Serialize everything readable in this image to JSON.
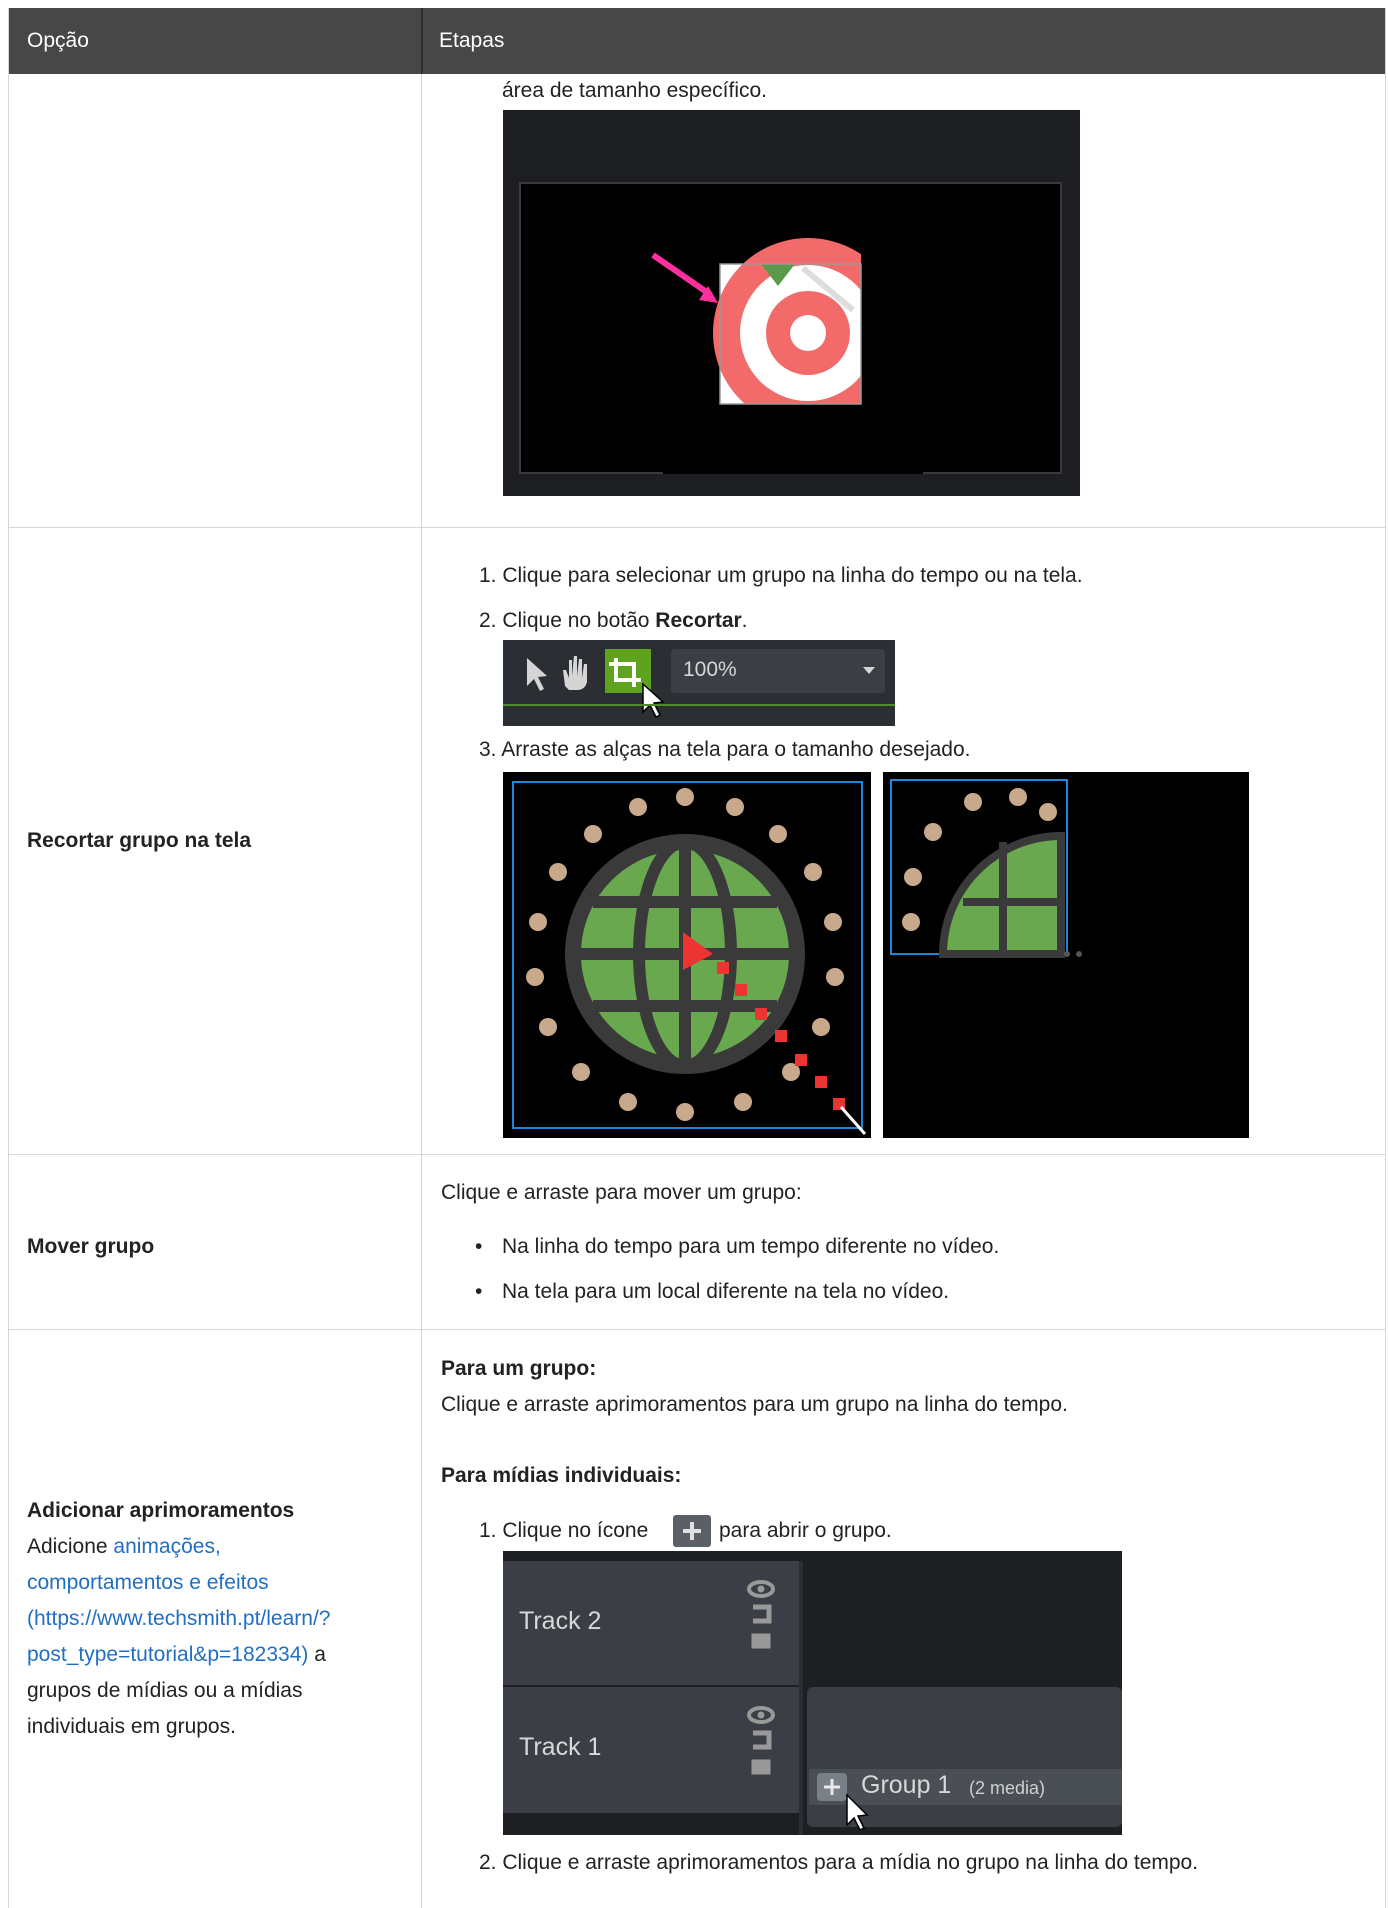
{
  "table": {
    "headers": [
      "Opção",
      "Etapas"
    ]
  },
  "row1": {
    "continued_text": "área de tamanho específico."
  },
  "row2": {
    "option": "Recortar grupo na tela",
    "steps": [
      "1. Clique para selecionar um grupo na linha do tempo ou na tela.",
      "2. Clique no botão ",
      "3. Arraste as alças na tela para o tamanho desejado."
    ],
    "step2_bold": "Recortar",
    "step2_end": ".",
    "toolbar_zoom": "100%"
  },
  "row3": {
    "option": "Mover grupo",
    "intro": "Clique e arraste para mover um grupo:",
    "bullets": [
      "Na linha do tempo para um tempo diferente no vídeo.",
      "Na tela para um local diferente na tela no vídeo."
    ]
  },
  "row4": {
    "option_title": "Adicionar aprimoramentos",
    "option_lines": [
      "Adicione ",
      "animações,",
      "comportamentos e efeitos",
      "(https://www.techsmith.pt/learn/?",
      "post_type=tutorial&p=182334)",
      " a",
      "grupos de mídias ou a mídias",
      "individuais em grupos."
    ],
    "for_group_label": "Para um grupo:",
    "for_group_text": "Clique e arraste aprimoramentos para um grupo na linha do tempo.",
    "for_media_label": "Para mídias individuais:",
    "step1_before": "1. Clique no ícone",
    "step1_after": "para abrir o grupo.",
    "tracks": [
      "Track 2",
      "Track 1"
    ],
    "group_name": "Group 1",
    "group_count": "(2 media)",
    "step2": "2. Clique e arraste aprimoramentos para a mídia no grupo na linha do tempo."
  }
}
